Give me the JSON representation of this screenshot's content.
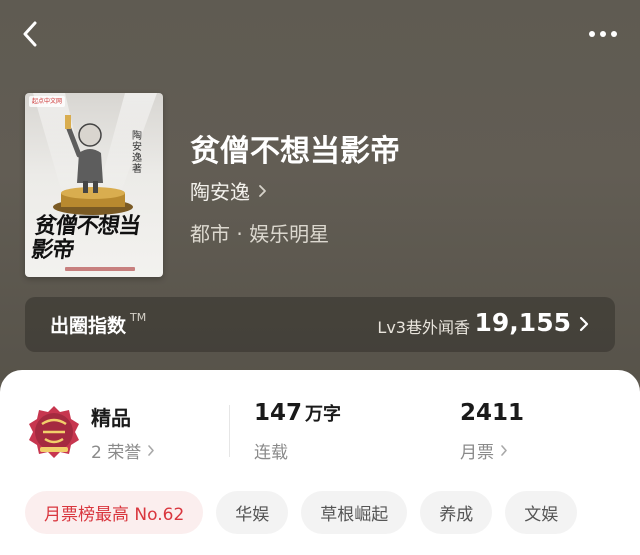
{
  "book": {
    "title": "贫僧不想当影帝",
    "author": "陶安逸",
    "genre": "都市 · 娱乐明星"
  },
  "cover": {
    "badge": "起点中文网",
    "title": "贫僧不想当影帝",
    "author": "陶安逸著"
  },
  "index_card": {
    "label": "出圈指数",
    "tm": "TM",
    "level": "Lv3巷外闻香",
    "value": "19,155"
  },
  "stats": {
    "quality": {
      "title": "精品",
      "sub": "2 荣誉"
    },
    "words": {
      "number": "147",
      "unit": "万字",
      "sub": "连载"
    },
    "tickets": {
      "number": "2411",
      "sub": "月票"
    }
  },
  "tags": [
    "月票榜最高 No.62",
    "华娱",
    "草根崛起",
    "养成",
    "文娱"
  ],
  "colors": {
    "accent_red": "#d9363e",
    "hero_bg": "#5f5b52",
    "panel_bg": "#ffffff"
  }
}
